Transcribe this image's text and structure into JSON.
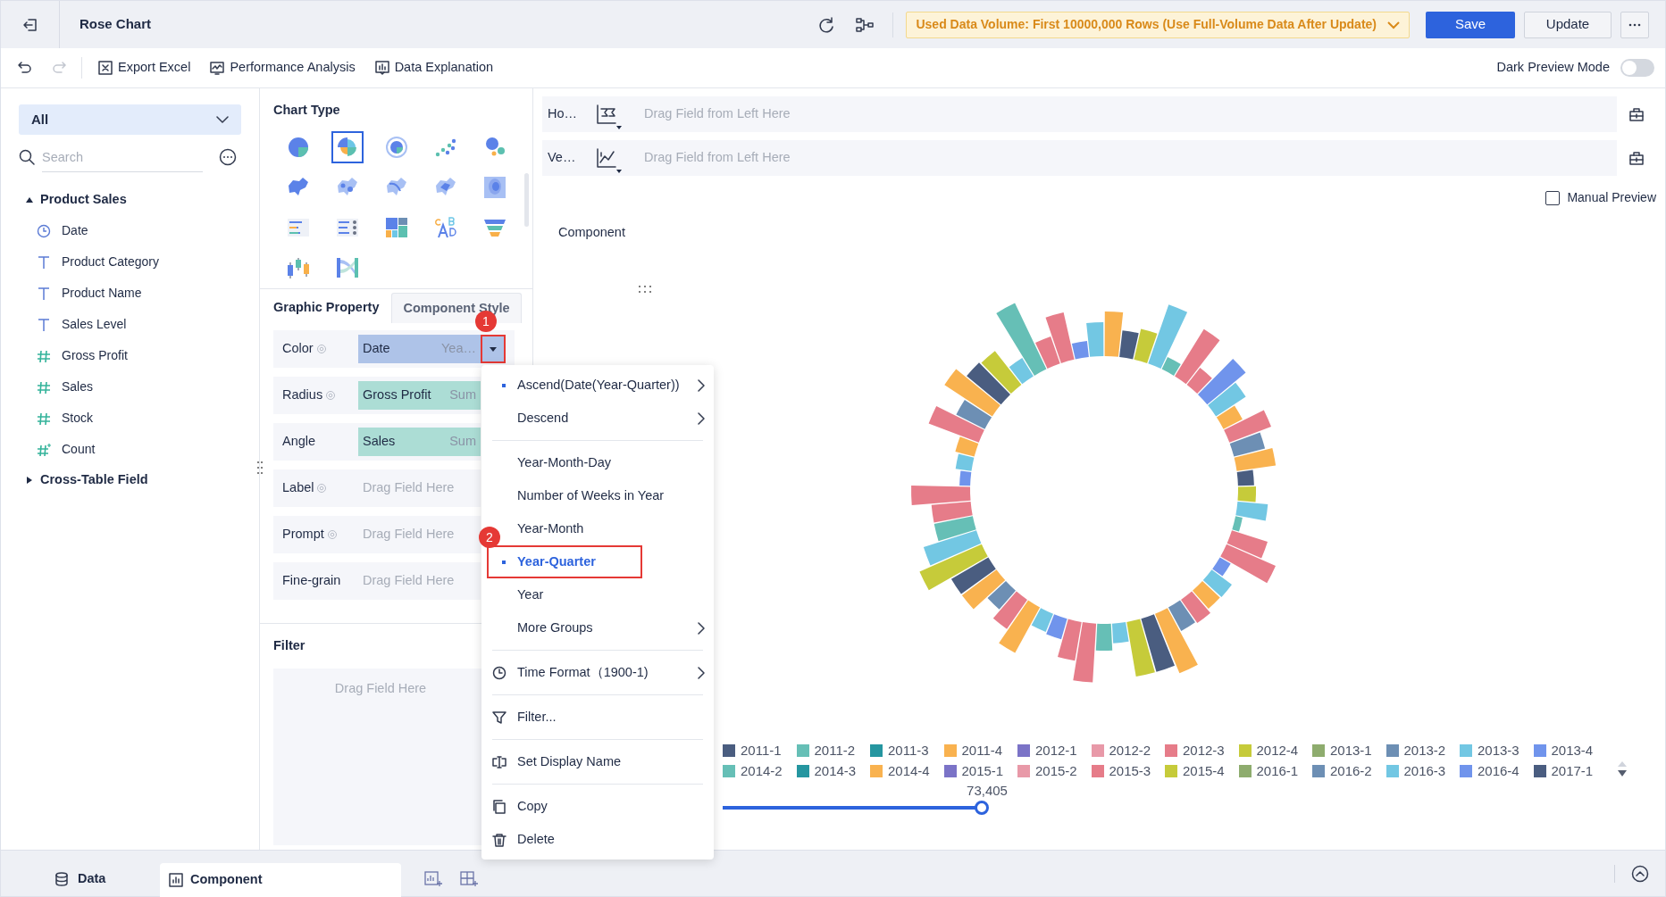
{
  "header": {
    "title": "Rose Chart",
    "notice": "Used Data Volume: First 10000,000 Rows (Use Full-Volume Data After Update)",
    "save": "Save",
    "update": "Update"
  },
  "toolbar": {
    "items": [
      {
        "kind": "excel",
        "label": "Export Excel"
      },
      {
        "kind": "performance",
        "label": "Performance Analysis"
      },
      {
        "kind": "explain",
        "label": "Data Explanation"
      }
    ],
    "dark_preview": {
      "label": "Dark Preview Mode",
      "on": false
    }
  },
  "field_panel": {
    "scope": "All",
    "search_placeholder": "Search",
    "groups": [
      {
        "label": "Product Sales",
        "expanded": true,
        "children": [
          {
            "kind": "date",
            "label": "Date"
          },
          {
            "kind": "text",
            "label": "Product Category"
          },
          {
            "kind": "text",
            "label": "Product Name"
          },
          {
            "kind": "text",
            "label": "Sales Level"
          },
          {
            "kind": "number",
            "label": "Gross Profit"
          },
          {
            "kind": "number",
            "label": "Sales"
          },
          {
            "kind": "number",
            "label": "Stock"
          },
          {
            "kind": "count",
            "label": "Count"
          }
        ]
      },
      {
        "label": "Cross-Table Field",
        "expanded": false
      }
    ]
  },
  "chart_type": {
    "title": "Chart Type",
    "types": [
      {
        "kind": "pie",
        "selected": false
      },
      {
        "kind": "rose",
        "selected": true
      },
      {
        "kind": "ring",
        "selected": false
      },
      {
        "kind": "scatter",
        "selected": false
      },
      {
        "kind": "bubble",
        "selected": false
      },
      {
        "kind": "region-map",
        "selected": false
      },
      {
        "kind": "point-map",
        "selected": false
      },
      {
        "kind": "flow-map",
        "selected": false
      },
      {
        "kind": "heat-map",
        "selected": false
      },
      {
        "kind": "contour",
        "selected": false
      },
      {
        "kind": "rank",
        "selected": false
      },
      {
        "kind": "list",
        "selected": false
      },
      {
        "kind": "treemap",
        "selected": false
      },
      {
        "kind": "word-cloud",
        "selected": false
      },
      {
        "kind": "funnel",
        "selected": false
      },
      {
        "kind": "candlestick",
        "selected": false
      },
      {
        "kind": "sankey",
        "selected": false
      }
    ]
  },
  "property_tabs": [
    {
      "label": "Graphic Property",
      "selected": true
    },
    {
      "label": "Component Style",
      "selected": false
    }
  ],
  "properties": [
    {
      "label": "Color",
      "settings": true,
      "field": {
        "name": "Date",
        "summary": "Yea…",
        "kind": "dimension"
      },
      "callout": "1"
    },
    {
      "label": "Radius",
      "settings": true,
      "field": {
        "name": "Gross Profit",
        "summary": "Sum",
        "kind": "measure"
      }
    },
    {
      "label": "Angle",
      "settings": false,
      "field": {
        "name": "Sales",
        "summary": "Sum",
        "kind": "measure"
      }
    },
    {
      "label": "Label",
      "settings": true,
      "placeholder": "Drag Field Here"
    },
    {
      "label": "Prompt",
      "settings": true,
      "placeholder": "Drag Field Here"
    },
    {
      "label": "Fine-grain",
      "settings": false,
      "placeholder": "Drag Field Here"
    }
  ],
  "filter": {
    "title": "Filter",
    "placeholder": "Drag Field Here"
  },
  "axes": [
    {
      "label": "Ho…",
      "placeholder": "Drag Field from Left Here"
    },
    {
      "label": "Ve…",
      "placeholder": "Drag Field from Left Here"
    }
  ],
  "manual_preview": {
    "label": "Manual Preview",
    "checked": false
  },
  "component_title": "Component",
  "legend": [
    {
      "label": "2011-1",
      "color": "#4a5d80"
    },
    {
      "label": "2011-2",
      "color": "#66bfb6"
    },
    {
      "label": "2011-3",
      "color": "#2596a0"
    },
    {
      "label": "2011-4",
      "color": "#f9b24f"
    },
    {
      "label": "2012-1",
      "color": "#7b73c7"
    },
    {
      "label": "2012-2",
      "color": "#e899a8"
    },
    {
      "label": "2012-3",
      "color": "#e67c89"
    },
    {
      "label": "2012-4",
      "color": "#c6cb3a"
    },
    {
      "label": "2013-1",
      "color": "#8eac6e"
    },
    {
      "label": "2013-2",
      "color": "#6d8fb4"
    },
    {
      "label": "2013-3",
      "color": "#72c7e3"
    },
    {
      "label": "2013-4",
      "color": "#7094ec"
    },
    {
      "label": "2014-2",
      "color": "#66bfb6"
    },
    {
      "label": "2014-3",
      "color": "#2596a0"
    },
    {
      "label": "2014-4",
      "color": "#f9b24f"
    },
    {
      "label": "2015-1",
      "color": "#7b73c7"
    },
    {
      "label": "2015-2",
      "color": "#e899a8"
    },
    {
      "label": "2015-3",
      "color": "#e67c89"
    },
    {
      "label": "2015-4",
      "color": "#c6cb3a"
    },
    {
      "label": "2016-1",
      "color": "#8eac6e"
    },
    {
      "label": "2016-2",
      "color": "#6d8fb4"
    },
    {
      "label": "2016-3",
      "color": "#72c7e3"
    },
    {
      "label": "2016-4",
      "color": "#7094ec"
    },
    {
      "label": "2017-1",
      "color": "#4a5d80"
    }
  ],
  "range_slider": {
    "reading": "73,405",
    "level": 1
  },
  "context_menu": {
    "items": [
      {
        "kind": "sort",
        "label": "Ascend(Date(Year-Quarter))",
        "selected": true,
        "submenu": true
      },
      {
        "kind": "sort",
        "label": "Descend",
        "selected": false,
        "submenu": true
      },
      {
        "kind": "separator"
      },
      {
        "kind": "group",
        "label": "Year-Month-Day",
        "selected": false
      },
      {
        "kind": "group",
        "label": "Number of Weeks in Year",
        "selected": false
      },
      {
        "kind": "group",
        "label": "Year-Month",
        "selected": false
      },
      {
        "kind": "group",
        "label": "Year-Quarter",
        "selected": true,
        "callout": "2"
      },
      {
        "kind": "group",
        "label": "Year",
        "selected": false
      },
      {
        "kind": "group",
        "label": "More Groups",
        "selected": false,
        "submenu": true
      },
      {
        "kind": "separator"
      },
      {
        "kind": "time-format",
        "label": "Time Format（1900-1)",
        "submenu": true
      },
      {
        "kind": "separator"
      },
      {
        "kind": "filter",
        "label": "Filter..."
      },
      {
        "kind": "separator"
      },
      {
        "kind": "rename",
        "label": "Set Display Name"
      },
      {
        "kind": "separator"
      },
      {
        "kind": "copy",
        "label": "Copy"
      },
      {
        "kind": "delete",
        "label": "Delete"
      }
    ]
  },
  "bottom_tabs": [
    {
      "label": "Data",
      "kind": "data",
      "selected": false
    },
    {
      "label": "Component",
      "kind": "component",
      "selected": true
    }
  ]
}
